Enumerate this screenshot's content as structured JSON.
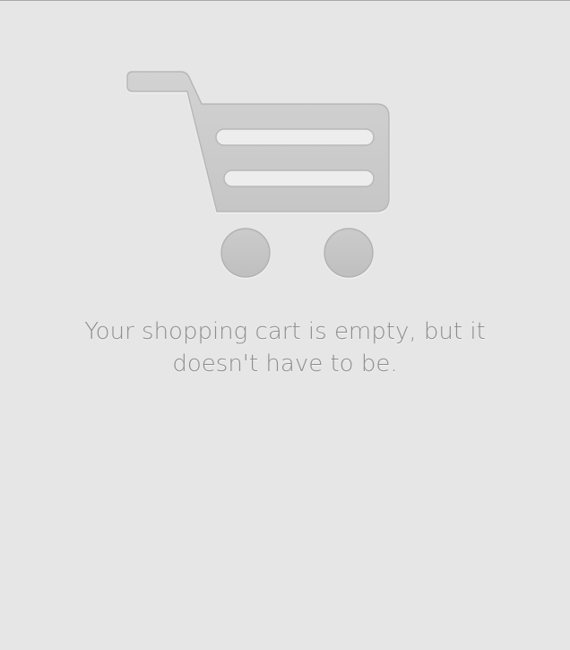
{
  "empty_state": {
    "icon": "shopping-cart-icon",
    "message": "Your shopping cart is empty, but it doesn't have to be."
  },
  "colors": {
    "background": "#e6e6e6",
    "icon_fill": "#c9c9c9",
    "text": "#8d8d8d"
  }
}
